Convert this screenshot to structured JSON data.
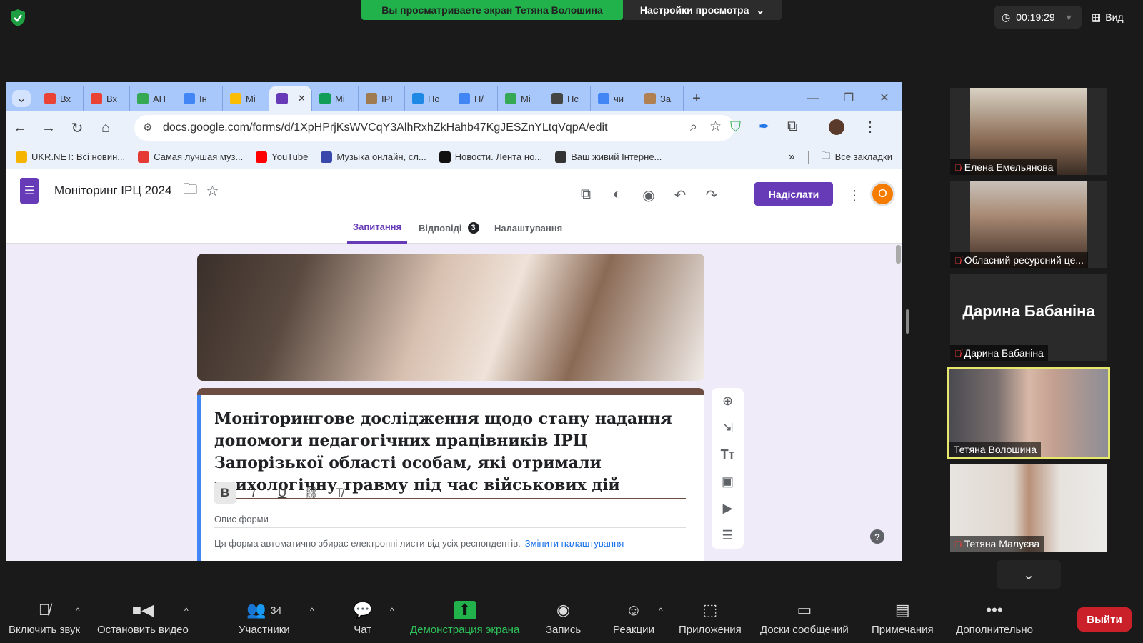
{
  "zoom": {
    "share_banner": "Вы просматриваете экран Тетяна Волошина",
    "view_options": "Настройки просмотра",
    "timer": "00:19:29",
    "view_label": "Вид",
    "participants": [
      {
        "name": "Елена Емельянова"
      },
      {
        "name": "Обласний ресурсний це..."
      },
      {
        "name": "Дарина Бабаніна",
        "big_name": "Дарина Бабаніна"
      },
      {
        "name": "Тетяна Волошина"
      },
      {
        "name": "Тетяна Малуєва"
      }
    ],
    "toolbar": {
      "mute": "Включить звук",
      "video": "Остановить видео",
      "participants": "Участники",
      "participants_count": "34",
      "chat": "Чат",
      "share": "Демонстрация экрана",
      "record": "Запись",
      "reactions": "Реакции",
      "apps": "Приложения",
      "whiteboards": "Доски сообщений",
      "notes": "Примечания",
      "more": "Дополнительно",
      "leave": "Выйти"
    }
  },
  "browser": {
    "tabs": [
      {
        "label": "Вх",
        "color": "#ea4335"
      },
      {
        "label": "Вх",
        "color": "#ea4335"
      },
      {
        "label": "АН",
        "color": "#34a853"
      },
      {
        "label": "Ін",
        "color": "#4285f4"
      },
      {
        "label": "Мі",
        "color": "#fbbc04"
      },
      {
        "label": "",
        "color": "#673ab7"
      },
      {
        "label": "Мі",
        "color": "#0f9d58"
      },
      {
        "label": "ІРІ",
        "color": "#a07a50"
      },
      {
        "label": "По",
        "color": "#1e88e5"
      },
      {
        "label": "П/",
        "color": "#4285f4"
      },
      {
        "label": "Мі",
        "color": "#34a853"
      },
      {
        "label": "Нс",
        "color": "#444444"
      },
      {
        "label": "чи",
        "color": "#4285f4"
      },
      {
        "label": "За",
        "color": "#b08050"
      }
    ],
    "url": "docs.google.com/forms/d/1XpHPrjKsWVCqY3AlhRxhZkHahb47KgJESZnYLtqVqpA/edit",
    "bookmarks": [
      {
        "label": "UKR.NET: Всі новин...",
        "color": "#f5b400"
      },
      {
        "label": "Самая лучшая муз...",
        "color": "#e53935"
      },
      {
        "label": "YouTube",
        "color": "#ff0000"
      },
      {
        "label": "Музыка онлайн, сл...",
        "color": "#3949ab"
      },
      {
        "label": "Новости. Лента но...",
        "color": "#111111"
      },
      {
        "label": "Ваш живий Інтерне...",
        "color": "#333333"
      }
    ],
    "all_bookmarks": "Все закладки"
  },
  "form": {
    "doc_title": "Моніторинг ІРЦ 2024",
    "send": "Надіслати",
    "avatar_letter": "О",
    "tabs": [
      "Запитання",
      "Відповіді",
      "Налаштування"
    ],
    "responses_count": "3",
    "title": "Моніторингове дослідження щодо стану надання допомоги педагогічних працівників ІРЦ Запорізької області особам, які отримали психологічну травму під час військових дій",
    "description_placeholder": "Опис форми",
    "note": "Ця форма автоматично збирає електронні листи від усіх респондентів.",
    "note_link": "Змінити налаштування",
    "accent": "#673ab7",
    "theme_color": "#6d4c41"
  }
}
